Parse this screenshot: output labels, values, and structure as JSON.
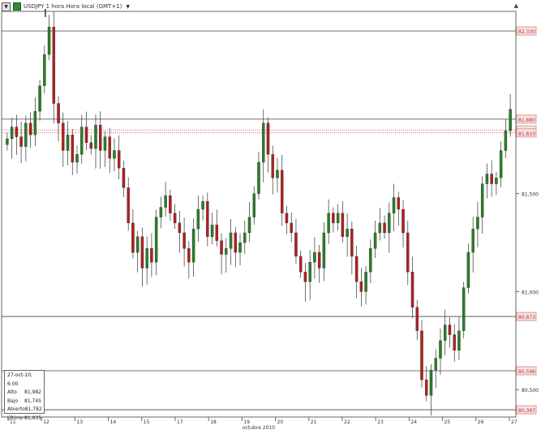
{
  "header": {
    "menu_icon": "dropdown-triangle-icon",
    "symbol_icon": "instrument-icon",
    "title": "USDJPY  1 hora Hora local (GMT+1)",
    "scroll_up_icon": "up-triangle-icon"
  },
  "axis": {
    "price_labels": [
      "81,500",
      "81,000",
      "80,500"
    ],
    "date_labels": [
      "11",
      "12",
      "13",
      "14",
      "15",
      "17",
      "18",
      "19",
      "20",
      "21",
      "22",
      "23",
      "24",
      "25",
      "26",
      "27"
    ],
    "month_label": "octubre 2010"
  },
  "levels": {
    "lines": [
      {
        "price": 82.33,
        "label": "82,330",
        "color": "#444444"
      },
      {
        "price": 81.88,
        "label": "81,880",
        "color": "#444444"
      },
      {
        "price": 80.873,
        "label": "80,873",
        "color": "#444444"
      },
      {
        "price": 80.596,
        "label": "80,596",
        "color": "#444444"
      },
      {
        "price": 80.397,
        "label": "80,397",
        "color": "#444444"
      }
    ],
    "dotted": [
      {
        "price": 81.825,
        "label": "81,825",
        "color": "#cc2222"
      },
      {
        "price": 81.81,
        "label": "81,810",
        "color": "#cc2222"
      }
    ]
  },
  "info": {
    "date": "27-oct-10, 6:00",
    "rows": [
      {
        "k": "Alto",
        "v": "81,982"
      },
      {
        "k": "Bajo",
        "v": "81,745"
      },
      {
        "k": "Abierto",
        "v": "81,782"
      },
      {
        "k": "Último",
        "v": "81,935"
      }
    ]
  },
  "colors": {
    "up": "#2a7d2a",
    "down": "#b02020",
    "wick": "#333333",
    "label_bg": "#f7e3e3",
    "label_border": "#d99",
    "label_text": "#b33"
  },
  "chart_data": {
    "type": "candlestick",
    "symbol": "USDJPY",
    "x_unit": "hour",
    "ylim": [
      80.36,
      82.43
    ],
    "y_ticks": [
      81.5,
      81.0,
      80.5
    ],
    "x_categories": [
      "11",
      "12",
      "13",
      "14",
      "15",
      "17",
      "18",
      "19",
      "20",
      "21",
      "22",
      "23",
      "24",
      "25",
      "26",
      "27"
    ],
    "series": [
      {
        "values": [
          81.78,
          81.84,
          81.79,
          81.74,
          81.86,
          81.8,
          81.92,
          82.05,
          82.21,
          82.35,
          81.96,
          81.86,
          81.72,
          81.8,
          81.66,
          81.7,
          81.84,
          81.76,
          81.73,
          81.85,
          81.72,
          81.79,
          81.68,
          81.72,
          81.63,
          81.53,
          81.35,
          81.2,
          81.28,
          81.12,
          81.22,
          81.15,
          81.38,
          81.43,
          81.49,
          81.4,
          81.35,
          81.3,
          81.22,
          81.15,
          81.32,
          81.42,
          81.46,
          81.28,
          81.34,
          81.26,
          81.19,
          81.22,
          81.3,
          81.2,
          81.25,
          81.3,
          81.38,
          81.5,
          81.66,
          81.86,
          81.7,
          81.58,
          81.62,
          81.4,
          81.35,
          81.3,
          81.18,
          81.1,
          81.05,
          81.15,
          81.2,
          81.12,
          81.3,
          81.4,
          81.35,
          81.4,
          81.28,
          81.32,
          81.18,
          81.05,
          81.0,
          81.1,
          81.22,
          81.3,
          81.35,
          81.3,
          81.4,
          81.48,
          81.42,
          81.3,
          81.1,
          80.92,
          80.8,
          80.55,
          80.47,
          80.6,
          80.66,
          80.75,
          80.83,
          80.78,
          80.7,
          80.8,
          81.02,
          81.2,
          81.32,
          81.38,
          81.55,
          81.6,
          81.55,
          81.58,
          81.72,
          81.82,
          81.93
        ]
      }
    ]
  }
}
